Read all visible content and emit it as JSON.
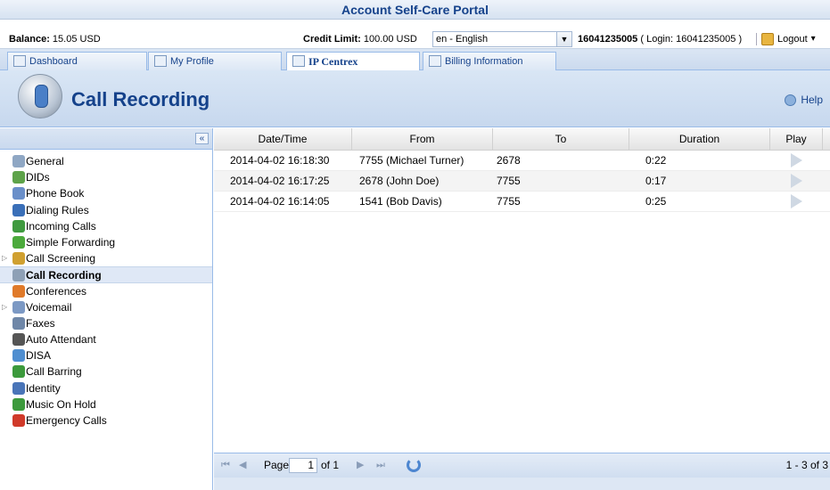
{
  "app": {
    "title": "Account Self-Care Portal"
  },
  "info": {
    "balance_label": "Balance:",
    "balance_value": "15.05 USD",
    "credit_label": "Credit Limit:",
    "credit_value": "100.00 USD",
    "language": "en - English",
    "account_number": "16041235005",
    "account_login": "( Login: 16041235005 )",
    "logout_label": "Logout",
    "logout_arrow": "▾"
  },
  "tabs": [
    {
      "label": "Dashboard"
    },
    {
      "label": "My Profile"
    },
    {
      "label": "IP Centrex",
      "active": true
    },
    {
      "label": "Billing Information"
    }
  ],
  "header": {
    "title": "Call Recording",
    "help_label": "Help"
  },
  "sidebar": {
    "collapse_label": "«",
    "items": [
      {
        "label": "General",
        "icon": "gear-icon",
        "color": "#8fa7c4"
      },
      {
        "label": "DIDs",
        "icon": "did-icon",
        "color": "#5ea34a"
      },
      {
        "label": "Phone Book",
        "icon": "phonebook-icon",
        "color": "#6a8fc9"
      },
      {
        "label": "Dialing Rules",
        "icon": "dialing-rules-icon",
        "color": "#3a6fb8"
      },
      {
        "label": "Incoming Calls",
        "icon": "incoming-calls-icon",
        "color": "#3f9a3f"
      },
      {
        "label": "Simple Forwarding",
        "icon": "forwarding-icon",
        "color": "#4caa3c"
      },
      {
        "label": "Call Screening",
        "icon": "call-screening-icon",
        "color": "#d0a030",
        "expandable": true
      },
      {
        "label": "Call Recording",
        "icon": "call-recording-icon",
        "color": "#8ea0b6",
        "active": true
      },
      {
        "label": "Conferences",
        "icon": "conferences-icon",
        "color": "#e07a2a"
      },
      {
        "label": "Voicemail",
        "icon": "voicemail-icon",
        "color": "#7c99c4",
        "expandable": true
      },
      {
        "label": "Faxes",
        "icon": "fax-icon",
        "color": "#6f87a8"
      },
      {
        "label": "Auto Attendant",
        "icon": "auto-attendant-icon",
        "color": "#555555"
      },
      {
        "label": "DISA",
        "icon": "disa-icon",
        "color": "#4f8ed0"
      },
      {
        "label": "Call Barring",
        "icon": "call-barring-icon",
        "color": "#3c9a3c"
      },
      {
        "label": "Identity",
        "icon": "identity-icon",
        "color": "#4a75b8"
      },
      {
        "label": "Music On Hold",
        "icon": "music-on-hold-icon",
        "color": "#3c9a3c"
      },
      {
        "label": "Emergency Calls",
        "icon": "emergency-calls-icon",
        "color": "#d03a2a"
      }
    ]
  },
  "grid": {
    "columns": [
      "Date/Time",
      "From",
      "To",
      "Duration",
      "Play"
    ],
    "rows": [
      {
        "datetime": "2014-04-02 16:18:30",
        "from": "7755 (Michael Turner)",
        "to": "2678",
        "duration": "0:22"
      },
      {
        "datetime": "2014-04-02 16:17:25",
        "from": "2678 (John Doe)",
        "to": "7755",
        "duration": "0:17"
      },
      {
        "datetime": "2014-04-02 16:14:05",
        "from": "1541 (Bob Davis)",
        "to": "7755",
        "duration": "0:25"
      }
    ]
  },
  "pager": {
    "page_label": "Page",
    "page_value": "1",
    "of_label": "of 1",
    "count_label": "1 - 3 of 3",
    "first": "⏮",
    "prev": "◀",
    "next": "▶",
    "last": "⏭"
  }
}
